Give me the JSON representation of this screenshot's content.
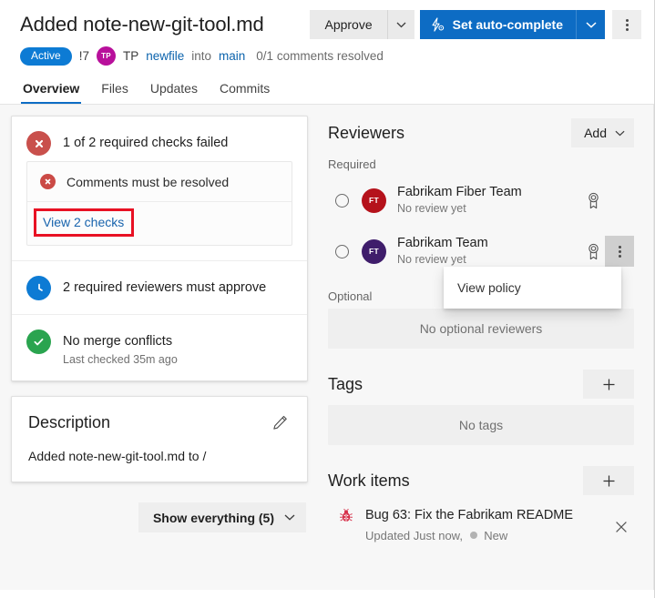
{
  "header": {
    "title": "Added note-new-git-tool.md",
    "approve_label": "Approve",
    "approve_caret_icon": "chevron-down-icon",
    "autocomplete_label": "Set auto-complete",
    "autocomplete_icon": "auto-complete-bolt-icon",
    "autocomplete_caret_icon": "chevron-down-icon",
    "more_icon": "more-vertical-icon",
    "status_badge": "Active",
    "pr_number": "!7",
    "author_initials": "TP",
    "author_name": "TP",
    "source_branch": "newfile",
    "into_word": "into",
    "target_branch": "main",
    "comments_resolved": "0/1 comments resolved",
    "accent_color": "#0d6cc4",
    "badge_color": "#0d7bd4",
    "author_avatar_color": "#b8109b"
  },
  "tabs": [
    {
      "label": "Overview",
      "active": true
    },
    {
      "label": "Files",
      "active": false
    },
    {
      "label": "Updates",
      "active": false
    },
    {
      "label": "Commits",
      "active": false
    }
  ],
  "status_card": {
    "checks_failed": {
      "icon": "error-circle-icon",
      "label": "1 of 2 required checks failed",
      "color": "#c9504c"
    },
    "check_item": {
      "icon": "error-circle-small-icon",
      "label": "Comments must be resolved"
    },
    "view_checks_link": "View 2 checks",
    "annotation_color": "#e81123",
    "reviewers_pending": {
      "icon": "clock-icon",
      "label": "2 required reviewers must approve",
      "color": "#0d7bd4"
    },
    "merge_conflicts": {
      "icon": "check-circle-icon",
      "label": "No merge conflicts",
      "sub": "Last checked 35m ago",
      "color": "#2aa44f"
    }
  },
  "description": {
    "title": "Description",
    "edit_icon": "pencil-icon",
    "body": "Added note-new-git-tool.md to /"
  },
  "show_everything": {
    "label": "Show everything (5)",
    "caret_icon": "chevron-down-icon"
  },
  "reviewers": {
    "title": "Reviewers",
    "add_label": "Add",
    "add_caret_icon": "chevron-down-icon",
    "required_label": "Required",
    "optional_label": "Optional",
    "optional_empty": "No optional reviewers",
    "items": [
      {
        "initials": "FT",
        "name": "Fabrikam Fiber Team",
        "status": "No review yet",
        "avatar_color": "#b5121b",
        "badge_icon": "required-ribbon-icon",
        "menu_open": false
      },
      {
        "initials": "FT",
        "name": "Fabrikam Team",
        "status": "No review yet",
        "avatar_color": "#3f1d6b",
        "badge_icon": "required-ribbon-icon",
        "menu_open": true
      }
    ]
  },
  "context_menu": {
    "items": [
      "View policy"
    ]
  },
  "tags": {
    "title": "Tags",
    "add_icon": "plus-icon",
    "empty": "No tags"
  },
  "work_items": {
    "title": "Work items",
    "add_icon": "plus-icon",
    "items": [
      {
        "icon": "bug-icon",
        "title": "Bug 63: Fix the Fabrikam README",
        "updated": "Updated Just now,",
        "state": "New",
        "remove_icon": "close-icon"
      }
    ]
  }
}
